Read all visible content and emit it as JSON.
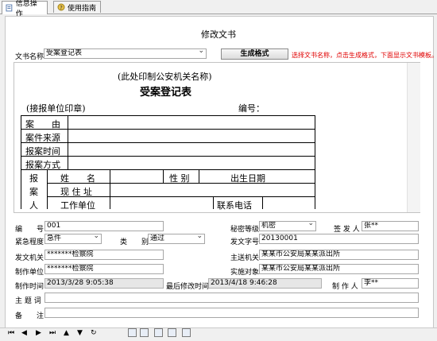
{
  "tabs": [
    {
      "label": "信息操作",
      "icon": "document-edit-icon"
    },
    {
      "label": "使用指南",
      "icon": "help-book-icon"
    }
  ],
  "title": "修改文书",
  "doc_name": {
    "label": "文书名称",
    "value": "受案登记表"
  },
  "generate_button": "生成格式",
  "hint": "选择文书名称，点击生成格式，下面显示文书模板。",
  "preview": {
    "org_placeholder": "(此处印制公安机关名称)",
    "form_title": "受案登记表",
    "stamp_note": "(接报单位印章)",
    "number_label": "编号：",
    "rows": [
      "案　　由",
      "案件来源",
      "报案时间",
      "报案方式"
    ],
    "reporter_side": [
      "报",
      "案",
      "人"
    ],
    "reporter_fields": [
      "姓　　名",
      "性 别",
      "出生日期",
      "现 住 址",
      "工作单位",
      "联系电话"
    ]
  },
  "fields": {
    "number": {
      "label": "编　　号",
      "value": "001"
    },
    "secrecy": {
      "label": "秘密等级",
      "value": "机密"
    },
    "signer": {
      "label": "签 发 人",
      "value": "张**"
    },
    "urgency": {
      "label": "紧急程度",
      "value": "急件"
    },
    "category": {
      "label": "类　　别",
      "value": "通过"
    },
    "doc_code": {
      "label": "发文字号",
      "value": "20130001"
    },
    "issuing_org": {
      "label": "发文机关",
      "value": "*******检察院"
    },
    "main_recipient": {
      "label": "主送机关",
      "value": "某某市公安局某某派出所"
    },
    "making_unit": {
      "label": "制作单位",
      "value": "*******检察院"
    },
    "target": {
      "label": "实施对象",
      "value": "某某市公安局某某派出所"
    },
    "made_time": {
      "label": "制作时间",
      "value": "2013/3/28 9:05:38"
    },
    "modified_time": {
      "label": "最后修改时间",
      "value": "2013/4/18 9:46:28"
    },
    "maker": {
      "label": "制 作 人",
      "value": "李**"
    },
    "subject": {
      "label": "主 题 词",
      "value": ""
    },
    "remark": {
      "label": "备　　注",
      "value": ""
    }
  },
  "nav": [
    "⏮",
    "◀",
    "▶",
    "⏭",
    "▲",
    "▼",
    "↻"
  ],
  "toolbar_icons": [
    "print-icon",
    "print-preview-icon",
    "zoom-icon",
    "export-icon",
    "close-icon"
  ]
}
